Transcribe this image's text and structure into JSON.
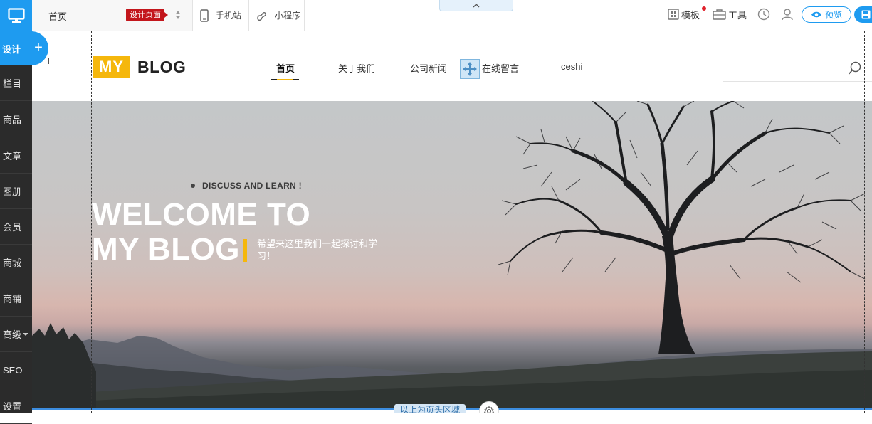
{
  "sidebar": {
    "design_label": "设计",
    "items": [
      "栏目",
      "商品",
      "文章",
      "图册",
      "会员",
      "商城",
      "商铺",
      "高级",
      "SEO",
      "设置"
    ]
  },
  "toolbar": {
    "page_name": "首页",
    "page_badge": "设计页面",
    "mobile_label": "手机站",
    "miniapp_label": "小程序",
    "template_label": "模板",
    "tools_label": "工具",
    "preview_label": "预览"
  },
  "site": {
    "logo_my": "MY",
    "logo_blog": "BLOG",
    "nav": [
      "首页",
      "关于我们",
      "公司新闻",
      "在线留言",
      "ceshi"
    ]
  },
  "hero": {
    "tagline": "DISCUSS AND LEARN !",
    "title_line1": "WELCOME TO",
    "title_line2": "MY BLOG",
    "subtitle": "希望来这里我们一起探讨和学习！"
  },
  "canvas": {
    "header_area_label": "以上为页头区域"
  },
  "colors": {
    "brand_blue": "#1e9bf0",
    "logo_yellow": "#f5b70c",
    "badge_red": "#c3161c",
    "sidebar_dark": "#2b2b2b"
  }
}
